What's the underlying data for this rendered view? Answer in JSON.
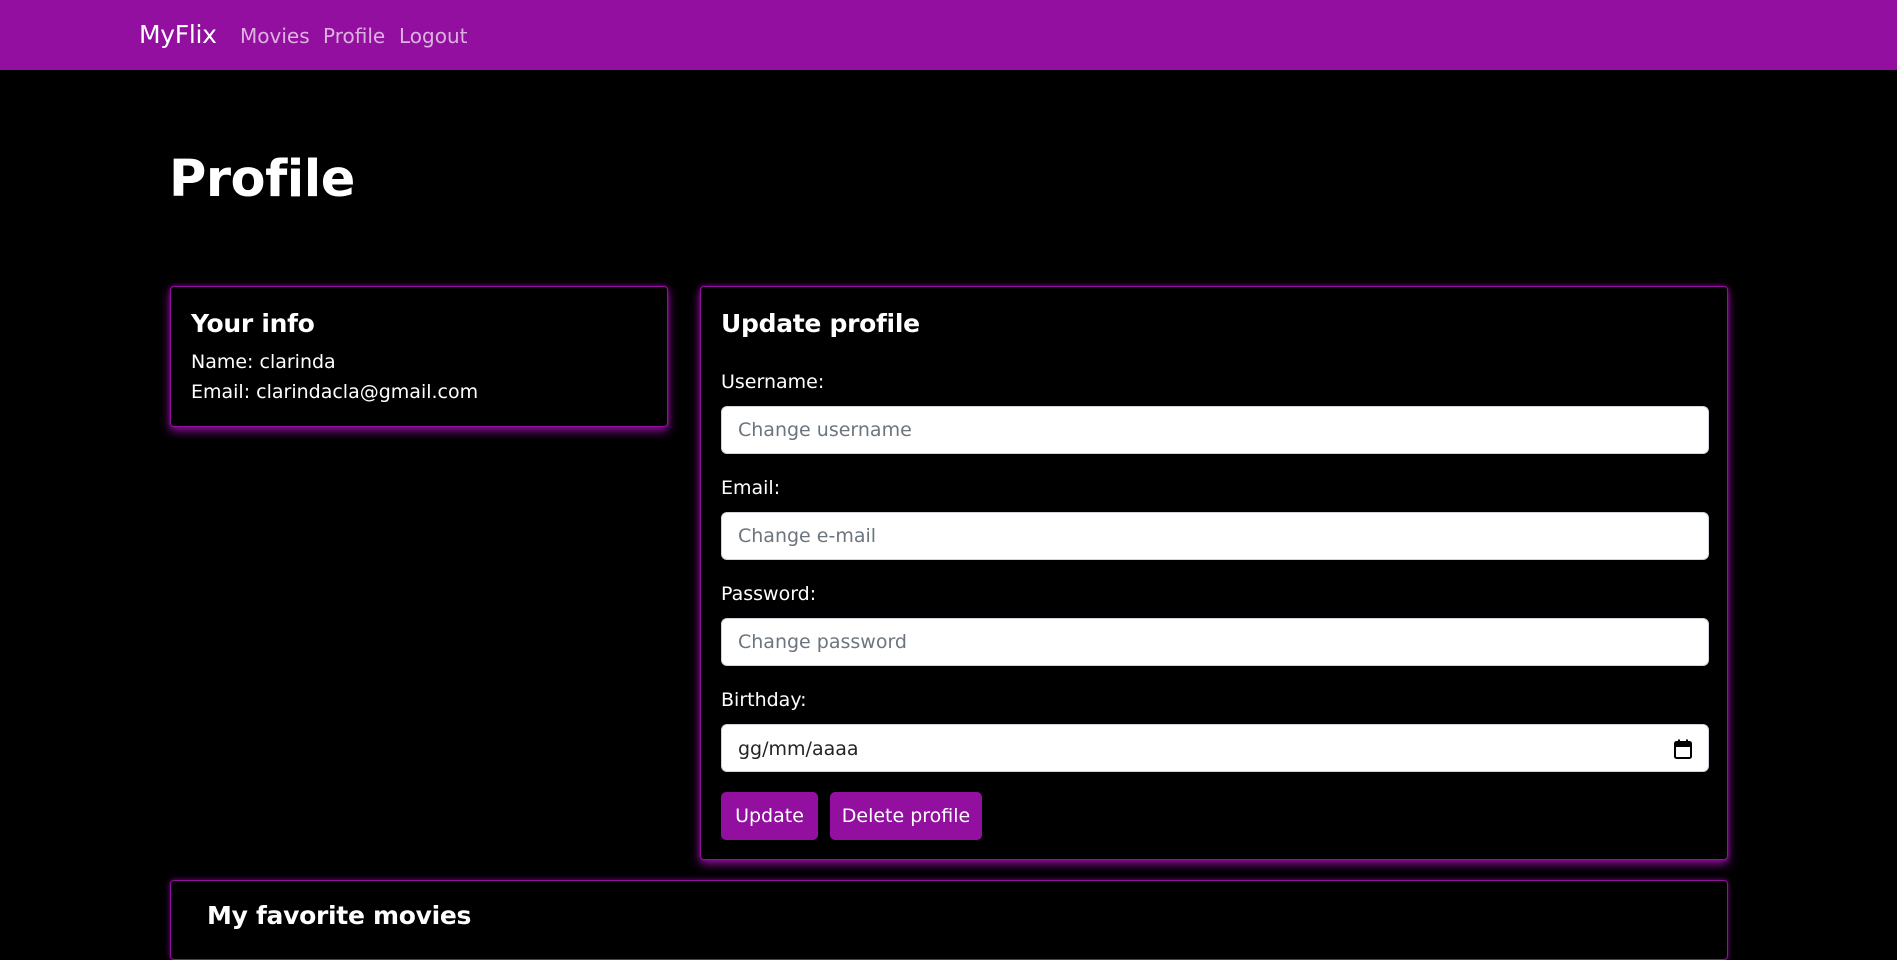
{
  "navbar": {
    "brand": "MyFlix",
    "links": [
      "Movies",
      "Profile",
      "Logout"
    ],
    "color": "#920f9f"
  },
  "page": {
    "title": "Profile"
  },
  "info_card": {
    "title": "Your info",
    "name_line": "Name: clarinda",
    "email_line": "Email: clarindacla@gmail.com"
  },
  "update_card": {
    "title": "Update profile",
    "username": {
      "label": "Username:",
      "placeholder": "Change username",
      "value": ""
    },
    "email": {
      "label": "Email:",
      "placeholder": "Change e-mail",
      "value": ""
    },
    "password": {
      "label": "Password:",
      "placeholder": "Change password",
      "value": ""
    },
    "birthday": {
      "label": "Birthday:",
      "display": "gg/mm/aaaa",
      "icon": "calendar-icon"
    },
    "update_button": "Update",
    "delete_button": "Delete profile"
  },
  "favorites_card": {
    "title": "My favorite movies"
  },
  "colors": {
    "accent": "#920f9f",
    "background": "#000000",
    "text": "#ffffff"
  }
}
